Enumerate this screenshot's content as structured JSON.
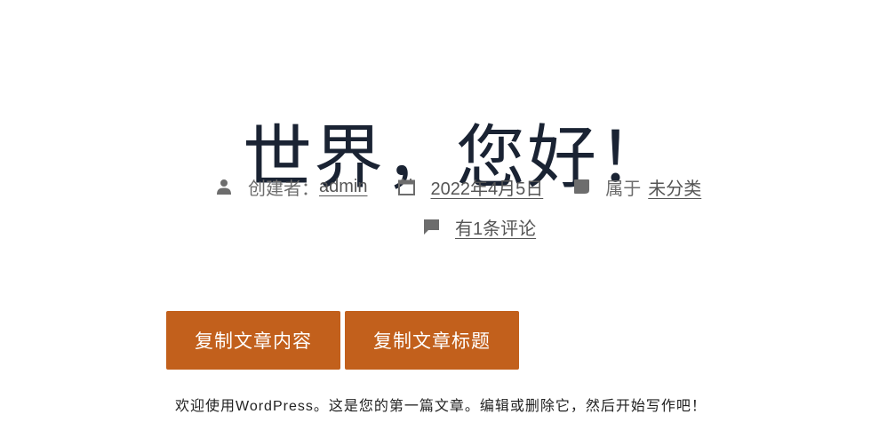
{
  "post": {
    "title": "世界，您好！",
    "author_prefix": "创建者：",
    "author": "admin",
    "date": "2022年4月5日",
    "category_prefix": "属于",
    "category": "未分类",
    "comments": "有1条评论",
    "body": "欢迎使用WordPress。这是您的第一篇文章。编辑或删除它，然后开始写作吧！"
  },
  "buttons": {
    "copy_content": "复制文章内容",
    "copy_title": "复制文章标题"
  },
  "icons": {
    "author": "person-icon",
    "date": "calendar-icon",
    "category": "folder-icon",
    "comments": "comment-icon"
  },
  "colors": {
    "title": "#1a2333",
    "meta": "#6d6d6d",
    "button_bg": "#c2601c",
    "button_text": "#ffffff"
  }
}
